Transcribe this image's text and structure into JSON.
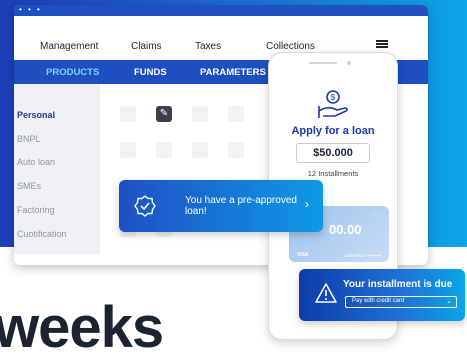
{
  "window": {
    "dots": "• • •"
  },
  "top_nav": [
    "Management",
    "Claims",
    "Taxes",
    "Collections"
  ],
  "icons": {
    "menu": "hamburger-menu-icon",
    "edit": "pencil-icon",
    "check_badge": "badge-check-icon",
    "loan": "hand-coin-icon",
    "warning": "warning-triangle-icon",
    "chevron_right": "chevron-right-icon",
    "chevron_down": "chevron-down-icon"
  },
  "sub_nav": {
    "items": [
      "PRODUCTS",
      "FUNDS",
      "PARAMETERS"
    ],
    "active": "PRODUCTS"
  },
  "sidebar": {
    "items": [
      "Personal",
      "BNPL",
      "Auto loan",
      "SMEs",
      "Factoring",
      "Cuotification"
    ],
    "selected": "Personal"
  },
  "notification_preapproved": {
    "message": "You have a pre-approved loan!",
    "chevron": "›"
  },
  "phone": {
    "title": "Apply for a loan",
    "amount": "$50.000",
    "installments": "12 Installments",
    "card": {
      "amount": "00.00",
      "dots": "···",
      "brand": "VISA",
      "number": "2340 5521 •••• ••••"
    }
  },
  "notification_installment": {
    "message": "Your installment is due",
    "select_value": "Pay with credit card"
  },
  "background_text": "weeks",
  "colors": {
    "accent": "#1d4fc1",
    "highlight": "#7fd0ff",
    "text": "#1b2430"
  }
}
